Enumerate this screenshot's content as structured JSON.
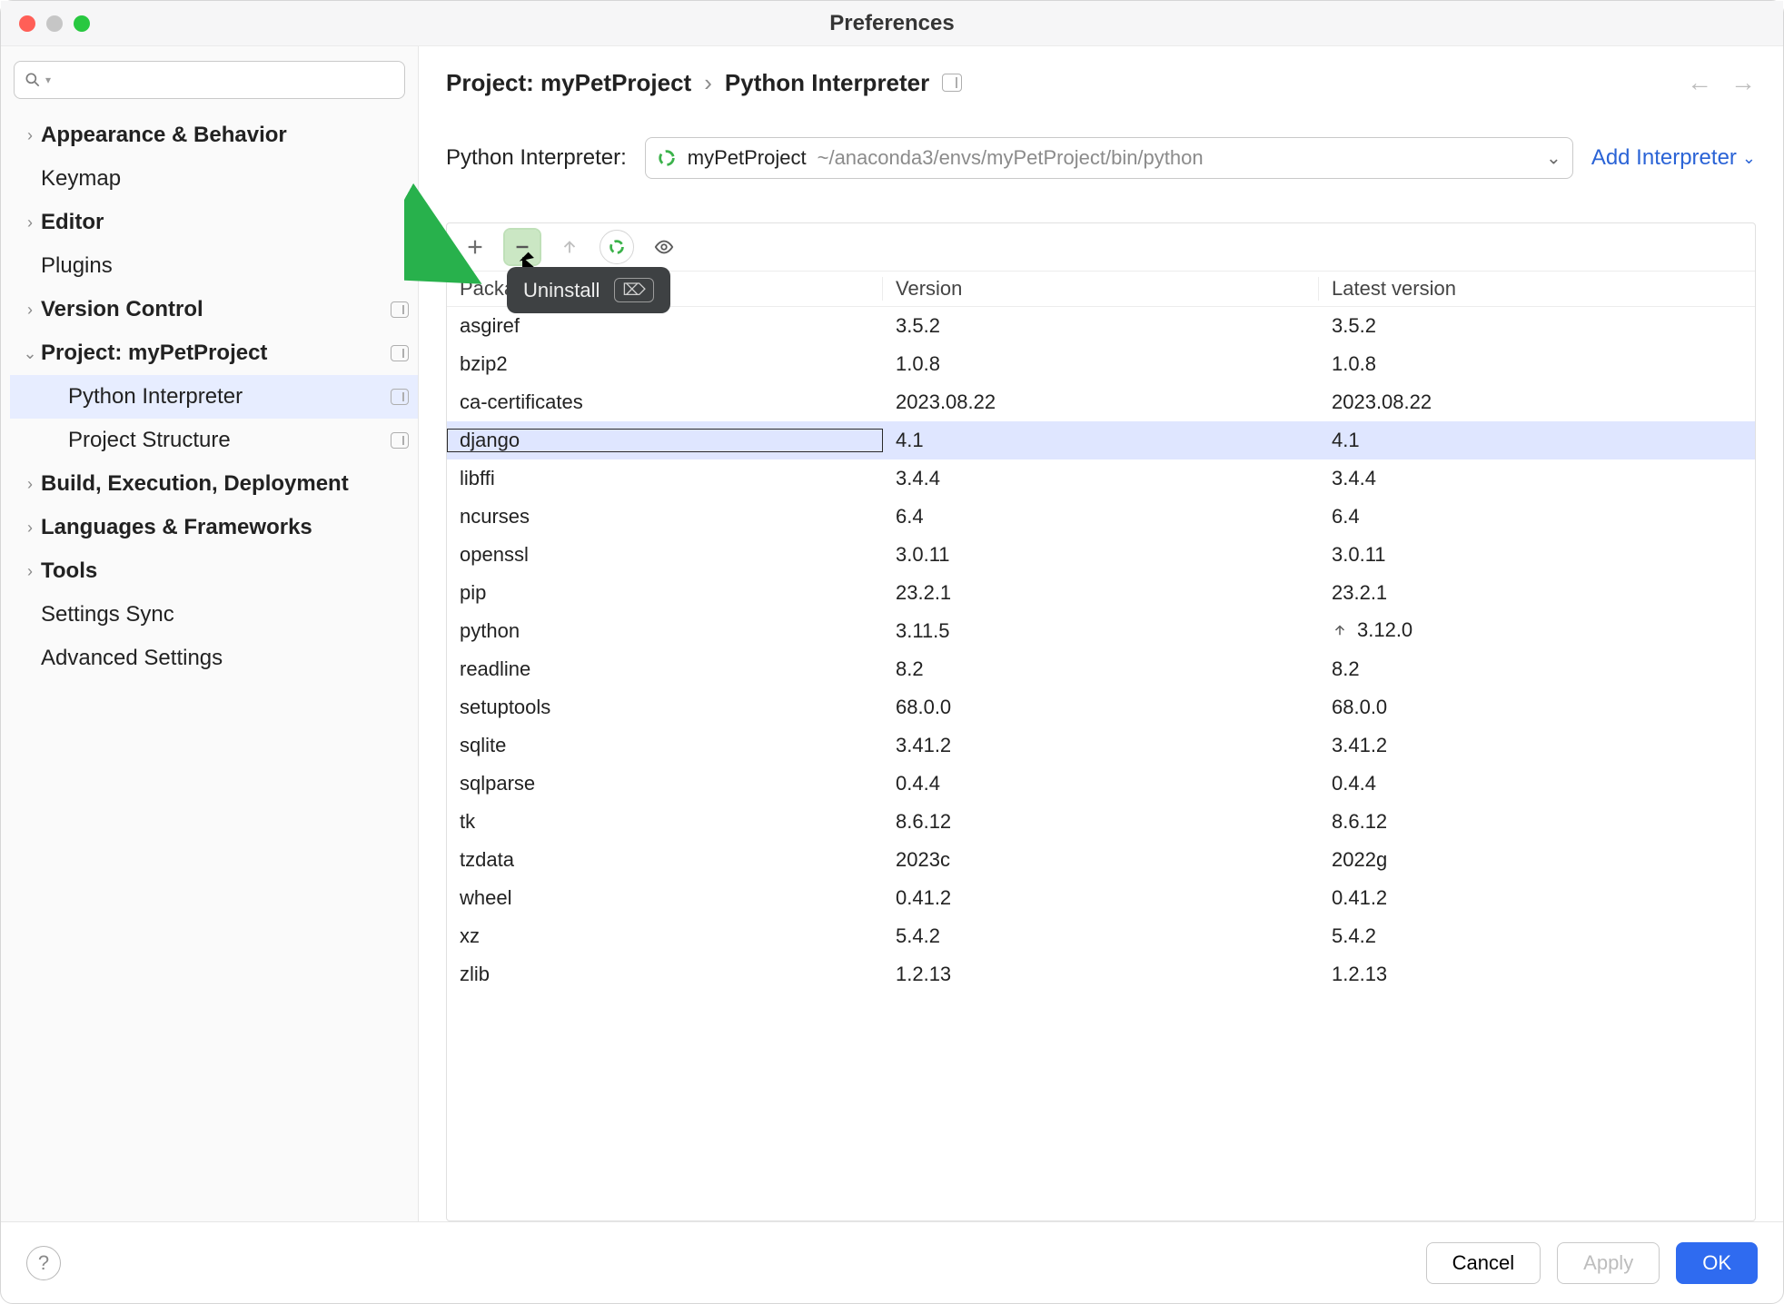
{
  "window": {
    "title": "Preferences"
  },
  "sidebar": {
    "search_placeholder": "",
    "items": [
      {
        "label": "Appearance & Behavior",
        "expandable": true,
        "indent": 0,
        "selected": false,
        "has_badge": false
      },
      {
        "label": "Keymap",
        "expandable": false,
        "indent": 0,
        "selected": false,
        "has_badge": false,
        "normal": true
      },
      {
        "label": "Editor",
        "expandable": true,
        "indent": 0,
        "selected": false,
        "has_badge": false
      },
      {
        "label": "Plugins",
        "expandable": false,
        "indent": 0,
        "selected": false,
        "has_badge": false,
        "normal": true
      },
      {
        "label": "Version Control",
        "expandable": true,
        "indent": 0,
        "selected": false,
        "has_badge": true
      },
      {
        "label": "Project: myPetProject",
        "expandable": true,
        "indent": 0,
        "selected": false,
        "has_badge": true,
        "open": true
      },
      {
        "label": "Python Interpreter",
        "expandable": false,
        "indent": 1,
        "selected": true,
        "has_badge": true,
        "normal": true
      },
      {
        "label": "Project Structure",
        "expandable": false,
        "indent": 1,
        "selected": false,
        "has_badge": true,
        "normal": true
      },
      {
        "label": "Build, Execution, Deployment",
        "expandable": true,
        "indent": 0,
        "selected": false,
        "has_badge": false
      },
      {
        "label": "Languages & Frameworks",
        "expandable": true,
        "indent": 0,
        "selected": false,
        "has_badge": false
      },
      {
        "label": "Tools",
        "expandable": true,
        "indent": 0,
        "selected": false,
        "has_badge": false
      },
      {
        "label": "Settings Sync",
        "expandable": false,
        "indent": 0,
        "selected": false,
        "has_badge": false,
        "normal": true
      },
      {
        "label": "Advanced Settings",
        "expandable": false,
        "indent": 0,
        "selected": false,
        "has_badge": false,
        "normal": true
      }
    ]
  },
  "breadcrumb": {
    "project": "Project: myPetProject",
    "sep": "›",
    "page": "Python Interpreter"
  },
  "interpreter": {
    "label": "Python Interpreter:",
    "selected_name": "myPetProject",
    "selected_path": "~/anaconda3/envs/myPetProject/bin/python",
    "add_label": "Add Interpreter"
  },
  "tooltip": {
    "text": "Uninstall",
    "key_glyph": "⌦"
  },
  "table": {
    "headers": {
      "package": "Package",
      "version": "Version",
      "latest": "Latest version"
    },
    "rows": [
      {
        "name": "asgiref",
        "version": "3.5.2",
        "latest": "3.5.2",
        "selected": false
      },
      {
        "name": "bzip2",
        "version": "1.0.8",
        "latest": "1.0.8",
        "selected": false
      },
      {
        "name": "ca-certificates",
        "version": "2023.08.22",
        "latest": "2023.08.22",
        "selected": false
      },
      {
        "name": "django",
        "version": "4.1",
        "latest": "4.1",
        "selected": true
      },
      {
        "name": "libffi",
        "version": "3.4.4",
        "latest": "3.4.4",
        "selected": false
      },
      {
        "name": "ncurses",
        "version": "6.4",
        "latest": "6.4",
        "selected": false
      },
      {
        "name": "openssl",
        "version": "3.0.11",
        "latest": "3.0.11",
        "selected": false
      },
      {
        "name": "pip",
        "version": "23.2.1",
        "latest": "23.2.1",
        "selected": false
      },
      {
        "name": "python",
        "version": "3.11.5",
        "latest": "3.12.0",
        "selected": false,
        "upgrade": true
      },
      {
        "name": "readline",
        "version": "8.2",
        "latest": "8.2",
        "selected": false
      },
      {
        "name": "setuptools",
        "version": "68.0.0",
        "latest": "68.0.0",
        "selected": false
      },
      {
        "name": "sqlite",
        "version": "3.41.2",
        "latest": "3.41.2",
        "selected": false
      },
      {
        "name": "sqlparse",
        "version": "0.4.4",
        "latest": "0.4.4",
        "selected": false
      },
      {
        "name": "tk",
        "version": "8.6.12",
        "latest": "8.6.12",
        "selected": false
      },
      {
        "name": "tzdata",
        "version": "2023c",
        "latest": "2022g",
        "selected": false
      },
      {
        "name": "wheel",
        "version": "0.41.2",
        "latest": "0.41.2",
        "selected": false
      },
      {
        "name": "xz",
        "version": "5.4.2",
        "latest": "5.4.2",
        "selected": false
      },
      {
        "name": "zlib",
        "version": "1.2.13",
        "latest": "1.2.13",
        "selected": false
      }
    ]
  },
  "footer": {
    "cancel": "Cancel",
    "apply": "Apply",
    "ok": "OK"
  }
}
